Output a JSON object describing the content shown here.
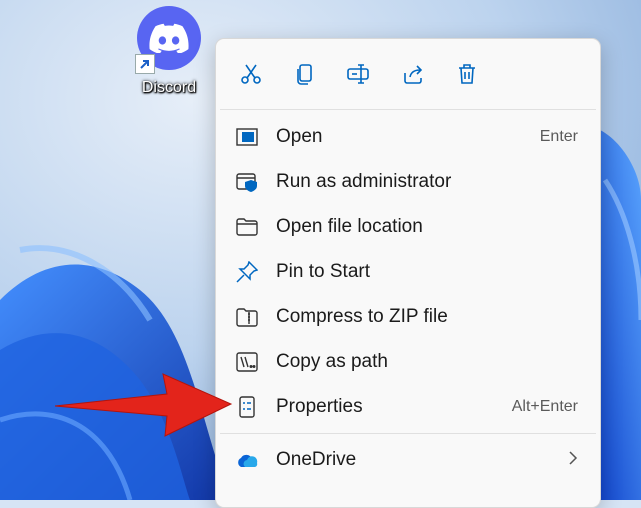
{
  "desktop": {
    "icon_label": "Discord"
  },
  "quick_actions": [
    {
      "name": "cut-icon"
    },
    {
      "name": "copy-icon"
    },
    {
      "name": "rename-icon"
    },
    {
      "name": "share-icon"
    },
    {
      "name": "delete-icon"
    }
  ],
  "menu": {
    "items": [
      {
        "label": "Open",
        "shortcut": "Enter",
        "icon": "open-icon"
      },
      {
        "label": "Run as administrator",
        "shortcut": "",
        "icon": "admin-shield-icon"
      },
      {
        "label": "Open file location",
        "shortcut": "",
        "icon": "folder-icon"
      },
      {
        "label": "Pin to Start",
        "shortcut": "",
        "icon": "pin-icon"
      },
      {
        "label": "Compress to ZIP file",
        "shortcut": "",
        "icon": "zip-icon"
      },
      {
        "label": "Copy as path",
        "shortcut": "",
        "icon": "copy-path-icon"
      },
      {
        "label": "Properties",
        "shortcut": "Alt+Enter",
        "icon": "properties-icon"
      }
    ],
    "onedrive_label": "OneDrive"
  },
  "colors": {
    "accent": "#0067c0",
    "discord": "#5865f2",
    "arrow": "#e3241b"
  }
}
